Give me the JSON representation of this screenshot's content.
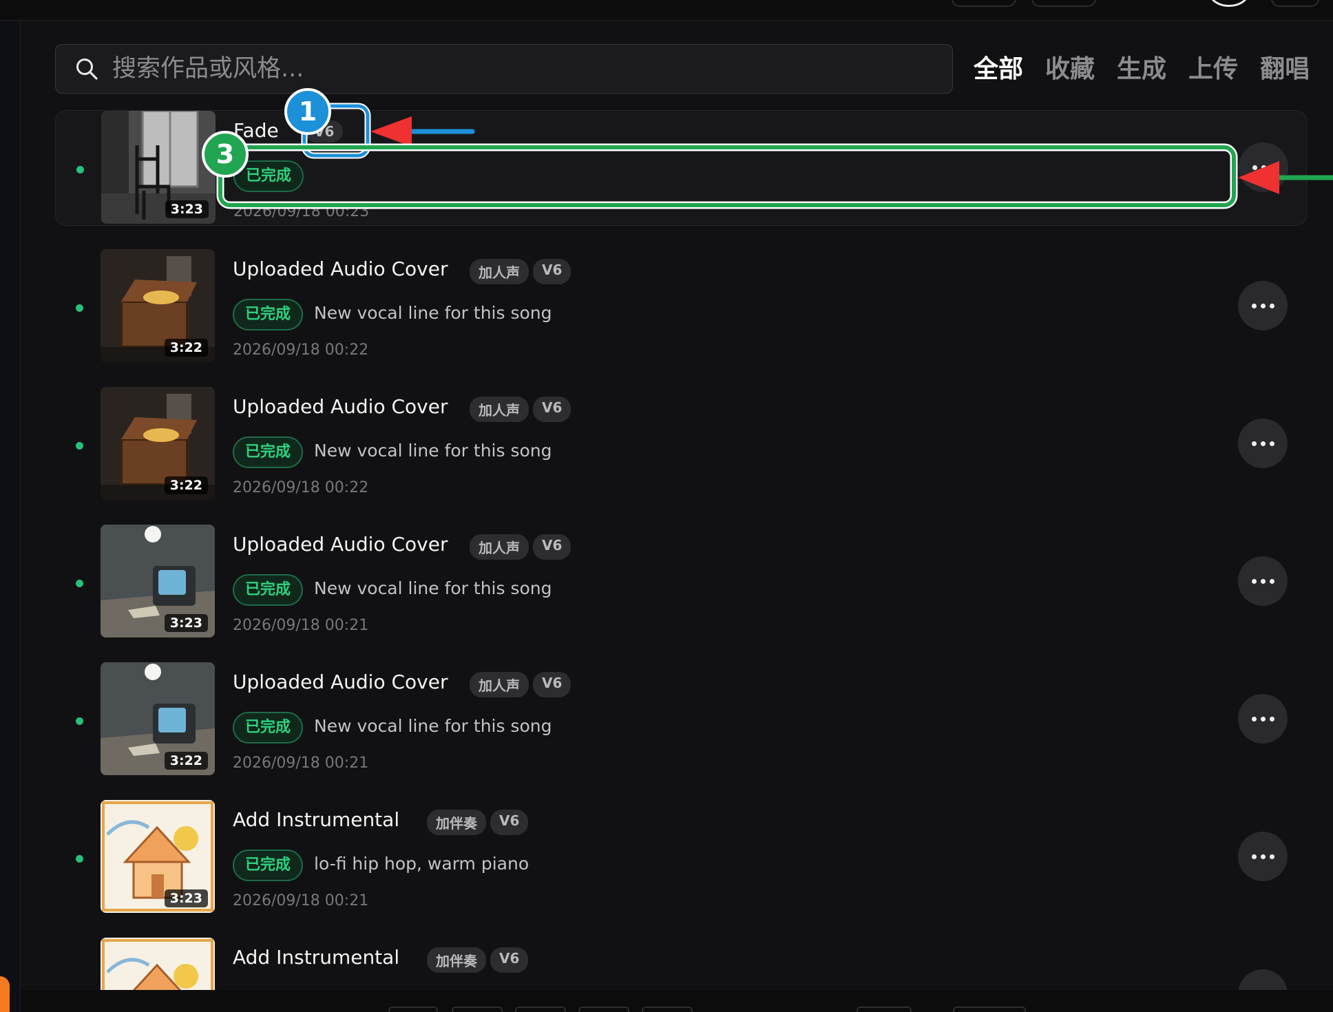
{
  "search": {
    "placeholder": "搜索作品或风格..."
  },
  "tabs": [
    {
      "label": "全部",
      "active": true
    },
    {
      "label": "收藏",
      "active": false
    },
    {
      "label": "生成",
      "active": false
    },
    {
      "label": "上传",
      "active": false
    },
    {
      "label": "翻唱",
      "active": false
    }
  ],
  "colors": {
    "status_green": "#2fd17f",
    "annotation_blue": "#1c90d8",
    "annotation_green": "#22a551",
    "annotation_red": "#f03131"
  },
  "songs": [
    {
      "title": "Fade",
      "tags": [
        "V6"
      ],
      "status": "已完成",
      "description": "",
      "date": "2026/09/18 00:23",
      "duration": "3:23",
      "thumb": "chair-room-icon"
    },
    {
      "title": "Uploaded Audio Cover",
      "tags": [
        "加人声",
        "V6"
      ],
      "status": "已完成",
      "description": "New vocal line for this song",
      "date": "2026/09/18 00:22",
      "duration": "3:22",
      "thumb": "treasure-chest-icon"
    },
    {
      "title": "Uploaded Audio Cover",
      "tags": [
        "加人声",
        "V6"
      ],
      "status": "已完成",
      "description": "New vocal line for this song",
      "date": "2026/09/18 00:22",
      "duration": "3:22",
      "thumb": "treasure-chest-icon"
    },
    {
      "title": "Uploaded Audio Cover",
      "tags": [
        "加人声",
        "V6"
      ],
      "status": "已完成",
      "description": "New vocal line for this song",
      "date": "2026/09/18 00:21",
      "duration": "3:23",
      "thumb": "crt-tv-room-icon"
    },
    {
      "title": "Uploaded Audio Cover",
      "tags": [
        "加人声",
        "V6"
      ],
      "status": "已完成",
      "description": "New vocal line for this song",
      "date": "2026/09/18 00:21",
      "duration": "3:22",
      "thumb": "crt-tv-room-icon"
    },
    {
      "title": "Add Instrumental",
      "tags": [
        "加伴奏",
        "V6"
      ],
      "status": "已完成",
      "description": "lo-fi hip hop, warm piano",
      "date": "2026/09/18 00:21",
      "duration": "3:23",
      "thumb": "sketch-house-icon"
    },
    {
      "title": "Add Instrumental",
      "tags": [
        "加伴奏",
        "V6"
      ],
      "status": "",
      "description": "",
      "date": "",
      "duration": "",
      "thumb": "sketch-house-icon"
    }
  ],
  "annotations": [
    {
      "label": "1",
      "color": "blue"
    },
    {
      "label": "3",
      "color": "green"
    }
  ]
}
